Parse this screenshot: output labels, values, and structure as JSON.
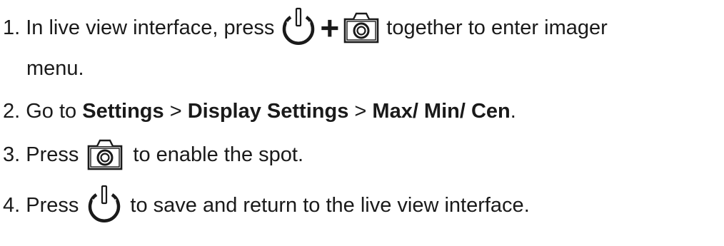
{
  "steps": [
    {
      "number": "1.",
      "text_before": "In live view interface, press",
      "plus": "+",
      "text_after": "together to enter imager",
      "text_continued": "menu.",
      "icons": [
        "power-icon",
        "camera-icon"
      ]
    },
    {
      "number": "2.",
      "text_before": "Go to",
      "bold_1": "Settings",
      "sep_1": ">",
      "bold_2": "Display Settings",
      "sep_2": ">",
      "bold_3": "Max/ Min/ Cen",
      "end": "."
    },
    {
      "number": "3.",
      "text_before": "Press",
      "text_after": "to enable the spot.",
      "icons": [
        "camera-icon"
      ]
    },
    {
      "number": "4.",
      "text_before": "Press",
      "text_after": "to save and return to the live view interface.",
      "icons": [
        "power-icon"
      ]
    }
  ]
}
